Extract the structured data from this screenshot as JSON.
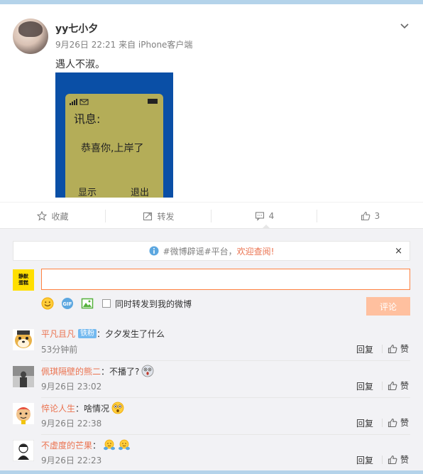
{
  "post": {
    "username": "yy七小夕",
    "meta": "9月26日 22:21 来自 iPhone客户端",
    "text": "遇人不淑。",
    "image": {
      "title": "讯息:",
      "body": "恭喜你,上岸了",
      "left_soft": "显示",
      "right_soft": "退出"
    }
  },
  "actions": {
    "favorite": "收藏",
    "repost": "转发",
    "comment_count": "4",
    "like_count": "3"
  },
  "notice": {
    "text": "#微博辟谣#平台，",
    "link": "欢迎查阅!",
    "close": "×"
  },
  "me": {
    "avatar_line1": "静默",
    "avatar_line2": "蛋糕"
  },
  "composer": {
    "placeholder": "",
    "sync_label": "同时转发到我的微博",
    "submit": "评论"
  },
  "comments": [
    {
      "name": "平凡且凡",
      "badge": "铁粉",
      "text": "：夕夕发生了什么",
      "time": "53分钟前",
      "reply": "回复",
      "like": "赞",
      "emoji": ""
    },
    {
      "name": "佩琪隔壁的熊二",
      "badge": "",
      "text": "：不播了?",
      "time": "9月26日 23:02",
      "reply": "回复",
      "like": "赞",
      "emoji": "shock"
    },
    {
      "name": "悴论人生",
      "badge": "",
      "text": "：啥情况",
      "time": "9月26日 22:38",
      "reply": "回复",
      "like": "赞",
      "emoji": "surprise"
    },
    {
      "name": "不虚度的芒果",
      "badge": "",
      "text": "：",
      "time": "9月26日 22:23",
      "reply": "回复",
      "like": "赞",
      "emoji": "hug"
    }
  ],
  "colors": {
    "accent": "#eb7350",
    "input_border": "#ff8140",
    "submit_bg": "#ffc09f",
    "page_bg": "#f2f2f5",
    "frame": "#b4d3ea",
    "badge": "#73b9ef"
  }
}
